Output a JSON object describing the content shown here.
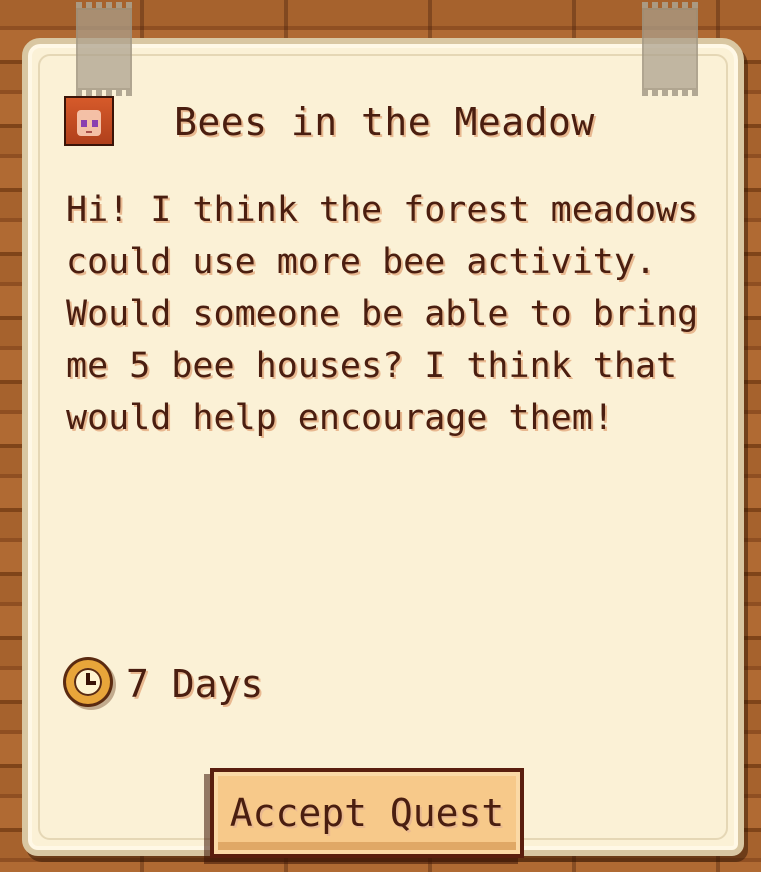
{
  "quest": {
    "title": "Bees in the Meadow",
    "description": "Hi! I think the forest meadows could use more bee activity. Would someone be able to bring me 5 bee houses? I think that would help encourage them!",
    "time_left": "7 Days",
    "accept_label": "Accept Quest"
  },
  "icons": {
    "portrait": "villager-portrait-icon",
    "clock": "clock-icon"
  },
  "colors": {
    "paper": "#fbf1d6",
    "text": "#4a1e10",
    "button": "#f7c98a",
    "wood": "#a6622d"
  }
}
